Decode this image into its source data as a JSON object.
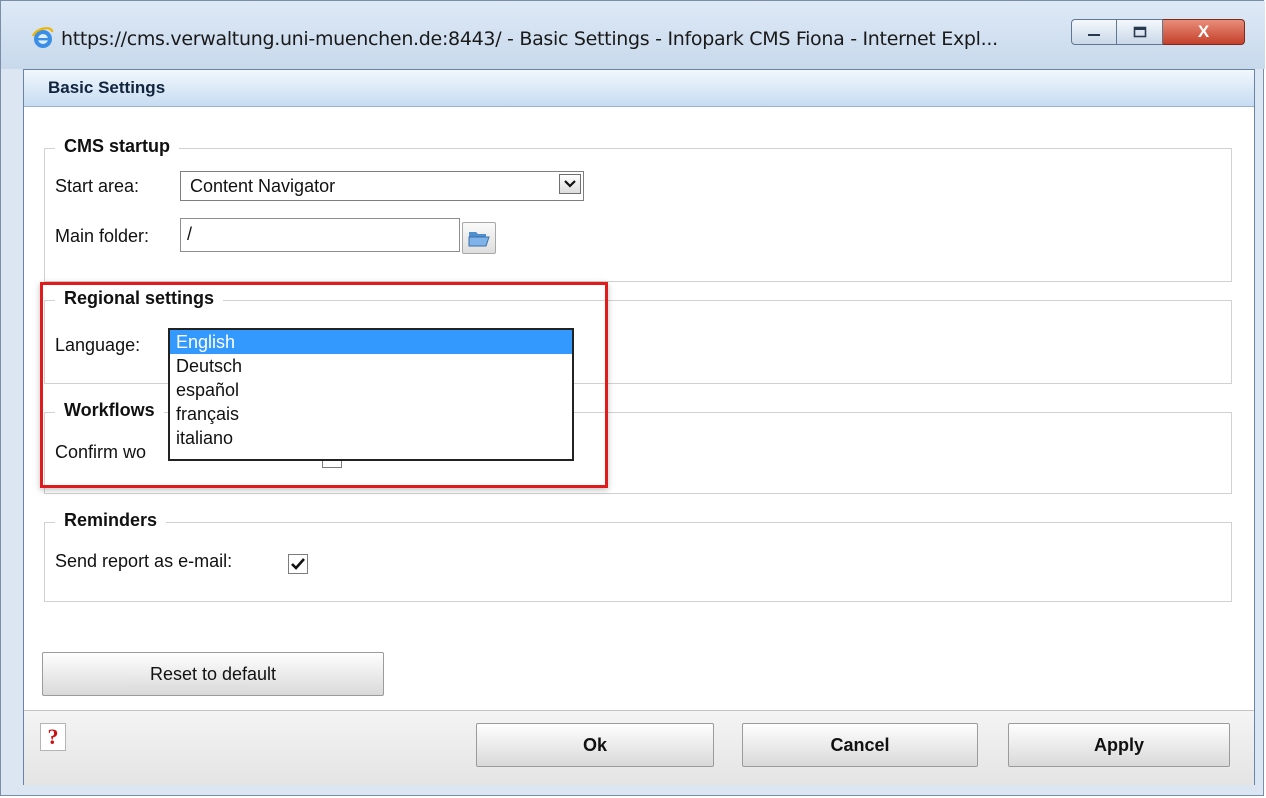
{
  "window": {
    "title": "https://cms.verwaltung.uni-muenchen.de:8443/ - Basic Settings - Infopark CMS Fiona - Internet Expl...",
    "close_label": "X"
  },
  "dialog": {
    "title": "Basic Settings"
  },
  "cms_startup": {
    "legend": "CMS startup",
    "start_area_label": "Start area:",
    "start_area_value": "Content Navigator",
    "main_folder_label": "Main folder:",
    "main_folder_value": "/"
  },
  "regional": {
    "legend": "Regional settings",
    "language_label": "Language:",
    "options": [
      "English",
      "Deutsch",
      "español",
      "français",
      "italiano"
    ],
    "selected": "English"
  },
  "workflows": {
    "legend": "Workflows",
    "confirm_label": "Confirm wo",
    "confirm_checked": false
  },
  "reminders": {
    "legend": "Reminders",
    "send_report_label": "Send report as e-mail:",
    "send_report_checked": true
  },
  "buttons": {
    "reset": "Reset to default",
    "ok": "Ok",
    "cancel": "Cancel",
    "apply": "Apply",
    "help": "?"
  },
  "colors": {
    "selection": "#3399ff",
    "highlight_box": "#e01b1b",
    "help_icon": "#cc1111"
  }
}
